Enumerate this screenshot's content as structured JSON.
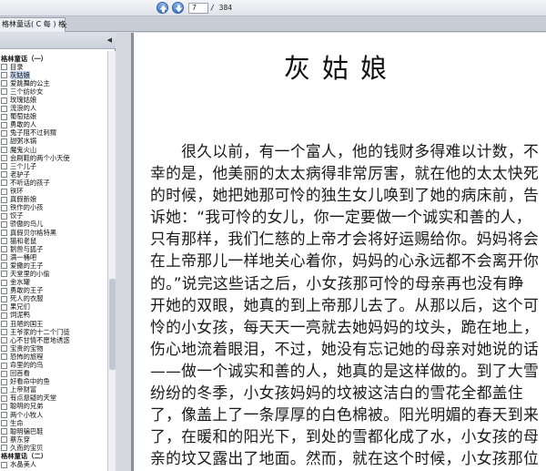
{
  "toolbar": {
    "page_current": "7",
    "page_total": "/ 384"
  },
  "tab": {
    "label": "格林童话( C 每 ) 格...",
    "close": "×"
  },
  "sidebar": {
    "items": [
      {
        "label": "格林童话（一）",
        "group": true
      },
      {
        "label": "目录"
      },
      {
        "label": "灰姑娘",
        "selected": true
      },
      {
        "label": "爱跳舞的公主"
      },
      {
        "label": "三个纺纱女"
      },
      {
        "label": "玫瑰姑娘"
      },
      {
        "label": "流浪的人"
      },
      {
        "label": "葡萄姑娘"
      },
      {
        "label": "勇敢的人"
      },
      {
        "label": "兔子阻不过刺猬"
      },
      {
        "label": "甜粥水锅"
      },
      {
        "label": "魔鬼火山"
      },
      {
        "label": "会刷鞋的两个小天使"
      },
      {
        "label": "三个儿子"
      },
      {
        "label": "老驴子"
      },
      {
        "label": "不听话的孩子"
      },
      {
        "label": "铁环"
      },
      {
        "label": "真假新娘"
      },
      {
        "label": "铁作的小孩"
      },
      {
        "label": "饺子"
      },
      {
        "label": "骄傲的鸟儿"
      },
      {
        "label": "真假贝尔格特黑"
      },
      {
        "label": "猫和老鼠"
      },
      {
        "label": "鹅兽与狐子"
      },
      {
        "label": "满一桶吧"
      },
      {
        "label": "爱撒的王子"
      },
      {
        "label": "天堂里的小偷"
      },
      {
        "label": "金水罐"
      },
      {
        "label": "勇敢的王子"
      },
      {
        "label": "死人的衣服"
      },
      {
        "label": "果兄们"
      },
      {
        "label": "饲泥鸭"
      },
      {
        "label": "丑陋的国王"
      },
      {
        "label": "王爷家的十二个门徒"
      },
      {
        "label": "心不甘情不愿地诱惑"
      },
      {
        "label": "宝贵的宝物"
      },
      {
        "label": "恐怖的旅程"
      },
      {
        "label": "命里的的鸟"
      },
      {
        "label": "回首看"
      },
      {
        "label": "好看命中的鱼"
      },
      {
        "label": "上帝财富"
      },
      {
        "label": "有点悬疑的天堂"
      },
      {
        "label": "聪明的兄弟"
      },
      {
        "label": "两个小牧人"
      },
      {
        "label": "生命"
      },
      {
        "label": "聪明骗巴鞋"
      },
      {
        "label": "蔡东穿"
      },
      {
        "label": "久而的宝贝"
      },
      {
        "label": "格林童话（二）",
        "group": true
      },
      {
        "label": "水晶美人"
      }
    ]
  },
  "document": {
    "title": "灰姑娘",
    "lines": [
      "　　很久以前，有一个富人，他的钱财多得难以计数，不",
      "幸的是，他美丽的太太病得非常厉害，就在他的太太快死",
      "的时候，她把她那可怜的独生女儿唤到了她的病床前，告",
      "诉她：“我可怜的女儿，你一定要做一个诚实和善的人，",
      "只有那样，我们仁慈的上帝才会将好运赐给你。妈妈将会",
      "在上帝那儿一样地关心着你，妈妈的心永远都不会离开你",
      "的。”说完这些话之后，小女孩那可怜的母亲再也没有睁",
      "开她的双眼，她真的到上帝那儿去了。从那以后，这个可",
      "怜的小女孩，每天天一亮就去她妈妈的坟头，跪在地上，",
      "伤心地流着眼泪，不过，她没有忘记她的母亲对她说的话",
      "——做一个诚实和善的人，她真的是这样做的。到了大雪",
      "纷纷的冬季，小女孩妈妈的坟被这洁白的雪花全都盖住",
      "了，像盖上了一条厚厚的白色棉被。阳光明媚的春天到来",
      "了，在暖和的阳光下，到处的雪都化成了水，小女孩的母",
      "亲的坟又露出了地面。然而，就在这个时候，小女孩那位"
    ]
  }
}
